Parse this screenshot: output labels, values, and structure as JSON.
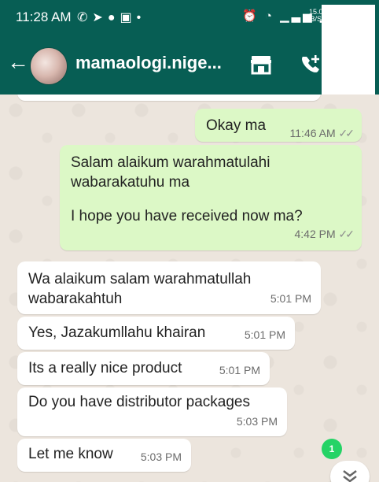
{
  "status_bar": {
    "time": "11:28 AM",
    "left_icons": [
      "whatsapp-icon",
      "telegram-icon",
      "chat-bubble-icon",
      "flipboard-icon",
      "dot-icon"
    ],
    "right_icons": [
      "alarm-icon",
      "wifi-icon",
      "signal-icon",
      "signal-icon"
    ],
    "rate_value": "15.0",
    "rate_unit": "B/S"
  },
  "header": {
    "contact_name": "mamaologi.nige...",
    "icons": [
      "back-arrow-icon",
      "store-icon",
      "add-call-icon"
    ],
    "background": "#075e54"
  },
  "messages": [
    {
      "direction": "out",
      "text": "Okay ma",
      "time": "11:46 AM",
      "ticks": "✓✓"
    },
    {
      "direction": "out",
      "text": "Salam alaikum warahmatulahi wabarakatuhu ma",
      "text2": "I hope you have received now ma?",
      "time": "4:42 PM",
      "ticks": "✓✓"
    },
    {
      "direction": "in",
      "text": "Wa alaikum salam warahmatullah wabarakahtuh",
      "time": "5:01 PM"
    },
    {
      "direction": "in",
      "text": "Yes, Jazakumllahu khairan",
      "time": "5:01 PM"
    },
    {
      "direction": "in",
      "text": "Its a really nice product",
      "time": "5:01 PM"
    },
    {
      "direction": "in",
      "text": "Do you have distributor packages",
      "time": "5:03 PM"
    },
    {
      "direction": "in",
      "text": "Let me know",
      "time": "5:03 PM"
    }
  ],
  "unread_badge": "1",
  "colors": {
    "outgoing_bubble": "#dcf8c6",
    "incoming_bubble": "#ffffff",
    "chat_background": "#ece5dd",
    "badge": "#25d366"
  }
}
